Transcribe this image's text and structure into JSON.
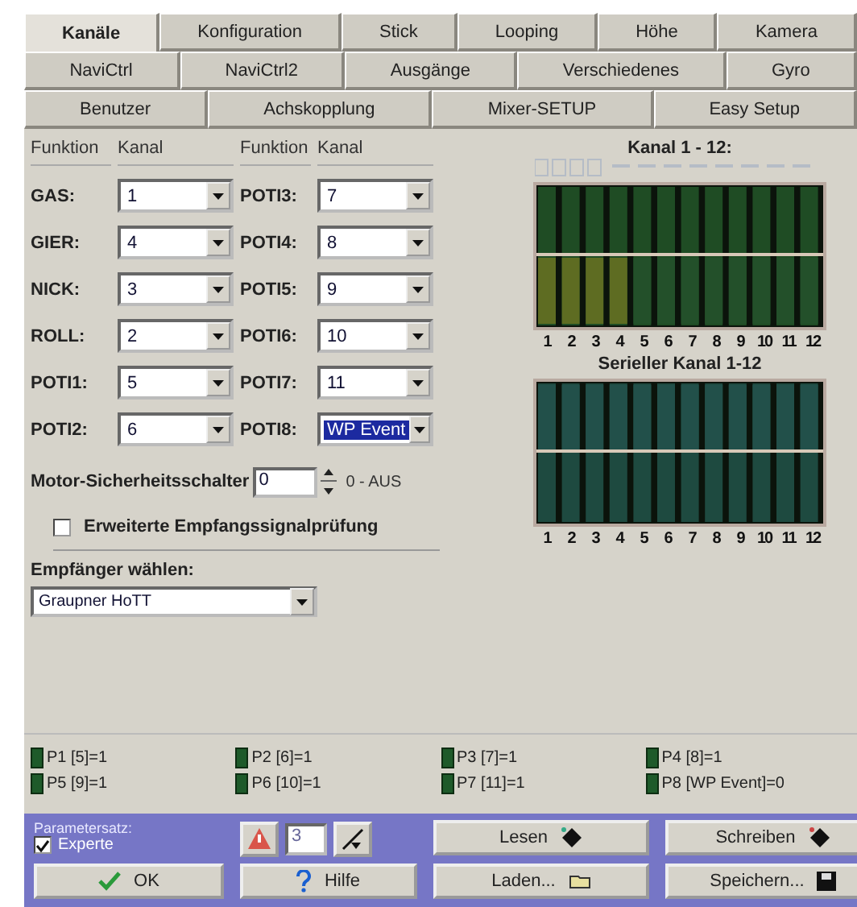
{
  "tab_rows": [
    {
      "tabs": [
        {
          "label": "Kanäle",
          "selected": true
        },
        {
          "label": "Konfiguration",
          "selected": false
        },
        {
          "label": "Stick",
          "selected": false
        },
        {
          "label": "Looping",
          "selected": false
        },
        {
          "label": "Höhe",
          "selected": false
        },
        {
          "label": "Kamera",
          "selected": false
        }
      ]
    },
    {
      "tabs": [
        {
          "label": "NaviCtrl",
          "selected": false
        },
        {
          "label": "NaviCtrl2",
          "selected": false
        },
        {
          "label": "Ausgänge",
          "selected": false
        },
        {
          "label": "Verschiedenes",
          "selected": false
        },
        {
          "label": "Gyro",
          "selected": false
        }
      ]
    },
    {
      "tabs": [
        {
          "label": "Benutzer",
          "selected": false
        },
        {
          "label": "Achskopplung",
          "selected": false
        },
        {
          "label": "Mixer-SETUP",
          "selected": false
        },
        {
          "label": "Easy Setup",
          "selected": false
        }
      ]
    }
  ],
  "channel_table": {
    "headers": [
      "Funktion",
      "Kanal",
      "Funktion",
      "Kanal"
    ],
    "rows": [
      {
        "left": {
          "function": "GAS:",
          "value": "1",
          "focused": false
        },
        "right": {
          "function": "POTI3:",
          "value": "7",
          "focused": false
        }
      },
      {
        "left": {
          "function": "GIER:",
          "value": "4",
          "focused": false
        },
        "right": {
          "function": "POTI4:",
          "value": "8",
          "focused": false
        }
      },
      {
        "left": {
          "function": "NICK:",
          "value": "3",
          "focused": false
        },
        "right": {
          "function": "POTI5:",
          "value": "9",
          "focused": false
        }
      },
      {
        "left": {
          "function": "ROLL:",
          "value": "2",
          "focused": false
        },
        "right": {
          "function": "POTI6:",
          "value": "10",
          "focused": false
        }
      },
      {
        "left": {
          "function": "POTI1:",
          "value": "5",
          "focused": false
        },
        "right": {
          "function": "POTI7:",
          "value": "11",
          "focused": false
        }
      },
      {
        "left": {
          "function": "POTI2:",
          "value": "6",
          "focused": false
        },
        "right": {
          "function": "POTI8:",
          "value": "WP Event",
          "focused": true
        }
      }
    ]
  },
  "motor_switch": {
    "label": "Motor-Sicherheitsschalter",
    "value": "0",
    "hint": "0 - AUS"
  },
  "signal_check": {
    "label": "Erweiterte Empfangssignalprüfung",
    "checked": false
  },
  "receiver": {
    "label": "Empfänger wählen:",
    "value": "Graupner HoTT"
  },
  "channel_charts": [
    {
      "title": "Kanal 1 - 12:",
      "labels": [
        "1",
        "2",
        "3",
        "4",
        "5",
        "6",
        "7",
        "8",
        "9",
        "10",
        "11",
        "12"
      ]
    },
    {
      "title": "Serieller Kanal 1-12",
      "labels": [
        "1",
        "2",
        "3",
        "4",
        "5",
        "6",
        "7",
        "8",
        "9",
        "10",
        "11",
        "12"
      ]
    }
  ],
  "poti_status": [
    "P1 [5]=1",
    "P2 [6]=1",
    "P3 [7]=1",
    "P4 [8]=1",
    "P5 [9]=1",
    "P6 [10]=1",
    "P7 [11]=1",
    "P8 [WP Event]=0"
  ],
  "footer": {
    "parameter_set_label": "Parametersatz:",
    "expert": {
      "label": "Experte",
      "checked": true
    },
    "parameter_set_value": "3",
    "buttons": {
      "ok": "OK",
      "help": "Hilfe",
      "read": "Lesen",
      "load": "Laden...",
      "write": "Schreiben",
      "save": "Speichern..."
    }
  }
}
